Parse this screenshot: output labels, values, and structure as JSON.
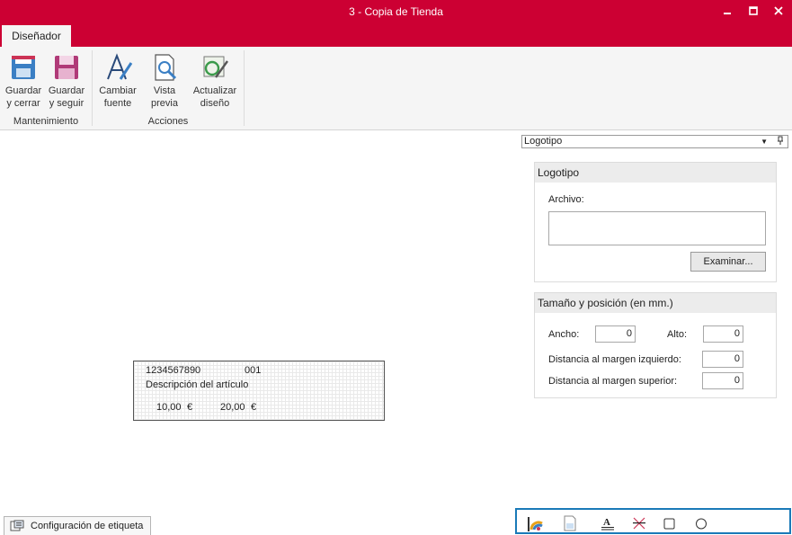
{
  "window": {
    "title": "3 - Copia de Tienda",
    "controls": {
      "minimize": "▬",
      "maximize": "□",
      "close": "✕"
    }
  },
  "ribbon": {
    "tabs": [
      {
        "label": "Diseñador",
        "active": true
      }
    ],
    "groups": [
      {
        "label": "Mantenimiento",
        "buttons": [
          {
            "line1": "Guardar",
            "line2": "y cerrar",
            "icon": "save-close-icon"
          },
          {
            "line1": "Guardar",
            "line2": "y seguir",
            "icon": "save-continue-icon"
          }
        ]
      },
      {
        "label": "Acciones",
        "buttons": [
          {
            "line1": "Cambiar",
            "line2": "fuente",
            "icon": "font-icon"
          },
          {
            "line1": "Vista",
            "line2": "previa",
            "icon": "preview-icon"
          },
          {
            "line1": "Actualizar",
            "line2": "diseño",
            "icon": "refresh-design-icon"
          }
        ]
      }
    ]
  },
  "label_preview": {
    "barcode": "1234567890",
    "code": "001",
    "description": "Descripción del artículo",
    "price1": "10,00",
    "currency1": "€",
    "price2": "20,00",
    "currency2": "€"
  },
  "properties": {
    "selector": {
      "value": "Logotipo",
      "arrow": "▼",
      "pin": "🖈"
    },
    "logo_panel": {
      "title": "Logotipo",
      "file_label": "Archivo:",
      "file_value": "",
      "browse_button": "Examinar..."
    },
    "size_panel": {
      "title": "Tamaño y posición (en mm.)",
      "width_label": "Ancho:",
      "width_value": "0",
      "height_label": "Alto:",
      "height_value": "0",
      "left_margin_label": "Distancia al margen izquierdo:",
      "left_margin_value": "0",
      "top_margin_label": "Distancia al margen superior:",
      "top_margin_value": "0"
    }
  },
  "status": {
    "config_tab": "Configuración de etiqueta"
  },
  "toolbox": {
    "tools": [
      "palette-icon",
      "image-tool-icon",
      "text-tool-icon",
      "line-tool-icon",
      "rectangle-tool-icon",
      "circle-tool-icon"
    ]
  },
  "colors": {
    "brand": "#cc0033",
    "ribbon_bg": "#f5f5f5",
    "toolbox_border": "#1a7ab8"
  }
}
